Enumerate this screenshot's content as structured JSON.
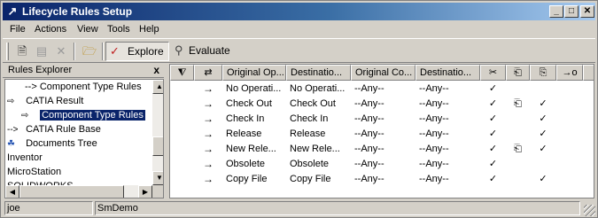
{
  "window": {
    "title": "Lifecycle Rules Setup"
  },
  "menu": [
    "File",
    "Actions",
    "View",
    "Tools",
    "Help"
  ],
  "toolbar": {
    "explore": "Explore",
    "evaluate": "Evaluate"
  },
  "explorer": {
    "title": "Rules Explorer",
    "close": "x",
    "items": [
      {
        "prefix": "-->",
        "label": "Component Type Rules"
      },
      {
        "prefix": "⇨",
        "label": "CATIA Result"
      },
      {
        "prefix": "⇨",
        "label": "Component Type Rules"
      },
      {
        "prefix": "-->",
        "label": "CATIA Rule Base"
      },
      {
        "prefix": "☘",
        "label": "Documents Tree"
      },
      {
        "prefix": "",
        "label": "Inventor"
      },
      {
        "prefix": "",
        "label": "MicroStation"
      },
      {
        "prefix": "",
        "label": "SOLIDWORKS"
      }
    ]
  },
  "grid": {
    "headers": [
      "⧨",
      "⇄",
      "Original Op...",
      "Destinatio...",
      "Original Co...",
      "Destinatio...",
      "✂",
      "⎗",
      "⎘",
      "→o"
    ],
    "rows": [
      {
        "arrow": "→",
        "orig_op": "No Operati...",
        "dest_op": "No Operati...",
        "orig_co": "--Any--",
        "dest_co": "--Any--",
        "c1": "✓",
        "c2": "",
        "c3": ""
      },
      {
        "arrow": "→",
        "orig_op": "Check Out",
        "dest_op": "Check Out",
        "orig_co": "--Any--",
        "dest_co": "--Any--",
        "c1": "✓",
        "c2": "⎗",
        "c3": "✓"
      },
      {
        "arrow": "→",
        "orig_op": "Check In",
        "dest_op": "Check In",
        "orig_co": "--Any--",
        "dest_co": "--Any--",
        "c1": "✓",
        "c2": "",
        "c3": "✓"
      },
      {
        "arrow": "→",
        "orig_op": "Release",
        "dest_op": "Release",
        "orig_co": "--Any--",
        "dest_co": "--Any--",
        "c1": "✓",
        "c2": "",
        "c3": "✓"
      },
      {
        "arrow": "→",
        "orig_op": "New Rele...",
        "dest_op": "New Rele...",
        "orig_co": "--Any--",
        "dest_co": "--Any--",
        "c1": "✓",
        "c2": "⎗",
        "c3": "✓"
      },
      {
        "arrow": "→",
        "orig_op": "Obsolete",
        "dest_op": "Obsolete",
        "orig_co": "--Any--",
        "dest_co": "--Any--",
        "c1": "✓",
        "c2": "",
        "c3": ""
      },
      {
        "arrow": "→",
        "orig_op": "Copy File",
        "dest_op": "Copy File",
        "orig_co": "--Any--",
        "dest_co": "--Any--",
        "c1": "✓",
        "c2": "",
        "c3": "✓"
      }
    ]
  },
  "status": {
    "user": "joe",
    "database": "SmDemo"
  }
}
